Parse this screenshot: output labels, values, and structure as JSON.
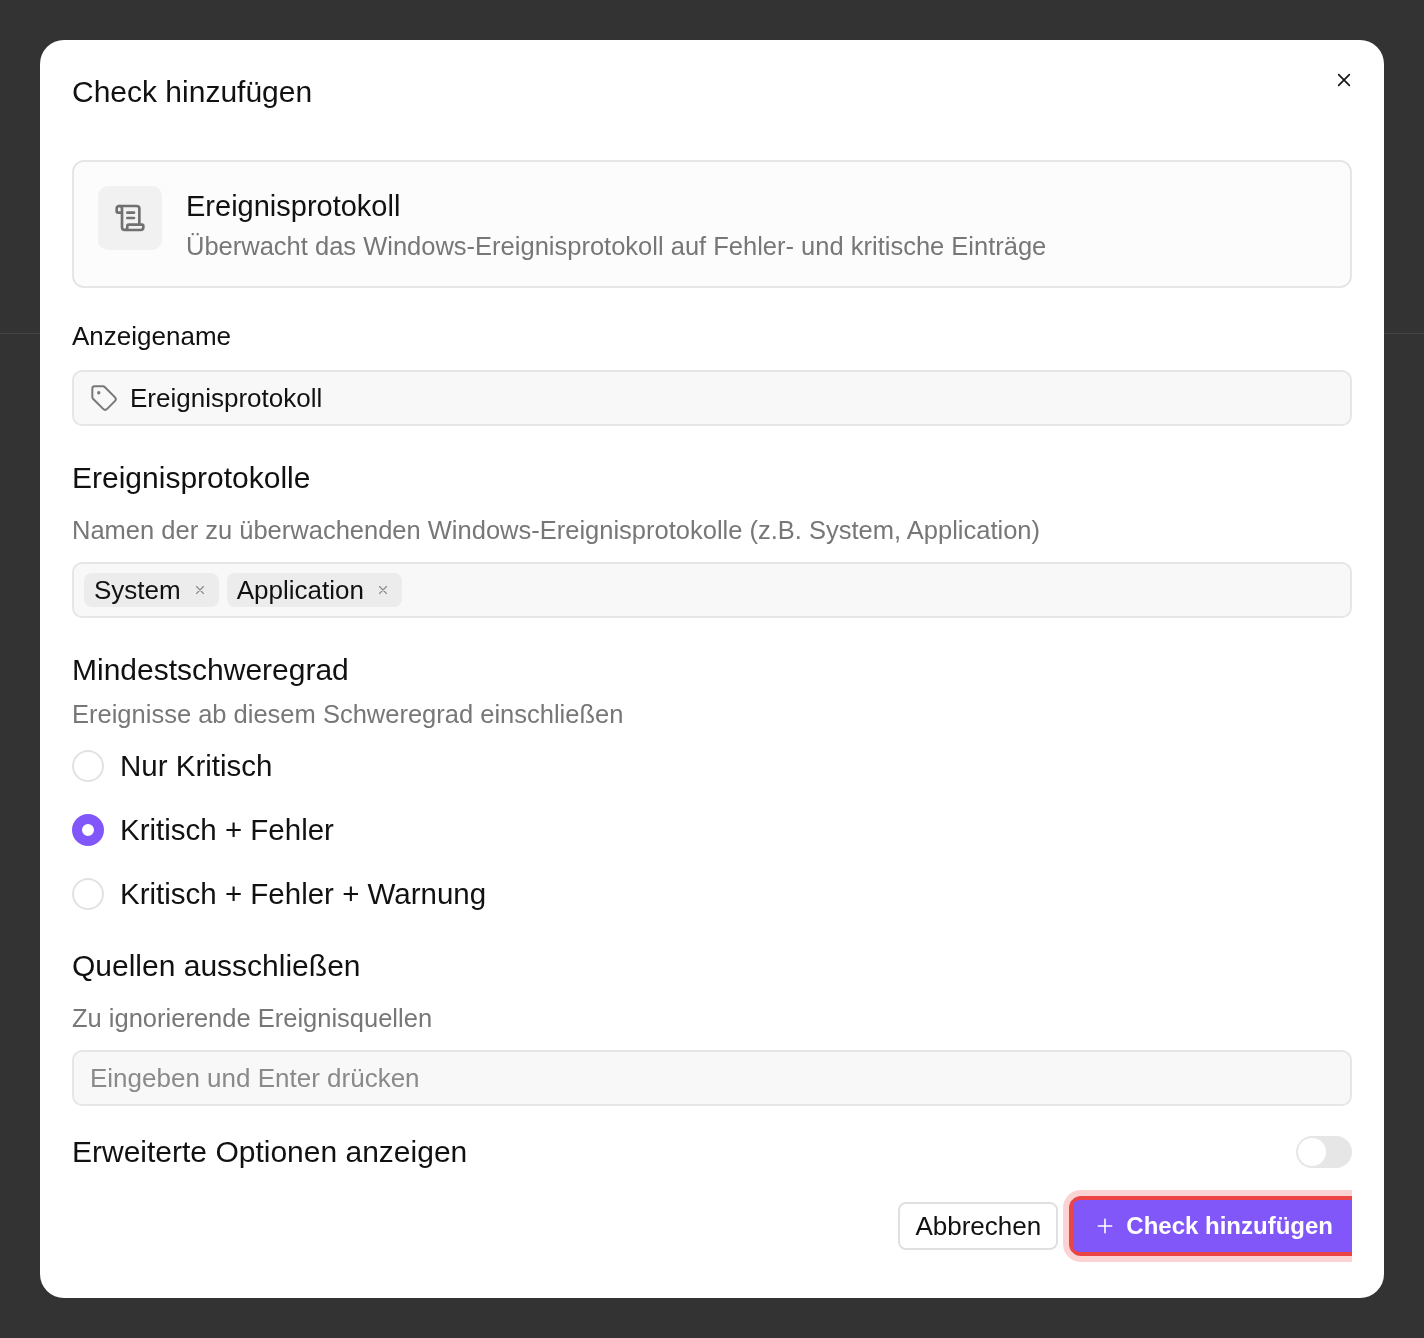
{
  "dialog": {
    "title": "Check hinzufügen"
  },
  "check_type": {
    "name": "Ereignisprotokoll",
    "description": "Überwacht das Windows-Ereignisprotokoll auf Fehler- und kritische Einträge"
  },
  "display_name": {
    "label": "Anzeigename",
    "value": "Ereignisprotokoll"
  },
  "event_logs": {
    "label": "Ereignisprotokolle",
    "description": "Namen der zu überwachenden Windows-Ereignisprotokolle (z.B. System, Application)",
    "tags": [
      "System",
      "Application"
    ]
  },
  "severity": {
    "label": "Mindestschweregrad",
    "description": "Ereignisse ab diesem Schweregrad einschließen",
    "options": [
      {
        "label": "Nur Kritisch",
        "selected": false
      },
      {
        "label": "Kritisch + Fehler",
        "selected": true
      },
      {
        "label": "Kritisch + Fehler + Warnung",
        "selected": false
      }
    ]
  },
  "exclude_sources": {
    "label": "Quellen ausschließen",
    "description": "Zu ignorierende Ereignisquellen",
    "placeholder": "Eingeben und Enter drücken"
  },
  "advanced": {
    "label": "Erweiterte Optionen anzeigen",
    "on": false
  },
  "buttons": [
    {
      "label": "Abbrechen",
      "kind": "secondary",
      "focused": false
    },
    {
      "label": "Check hinzufügen",
      "kind": "primary",
      "focused": true
    }
  ]
}
